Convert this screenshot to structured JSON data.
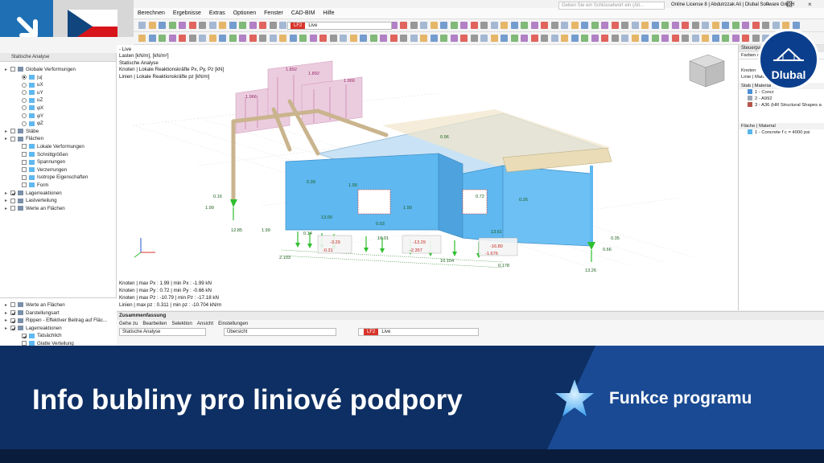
{
  "app": {
    "search_placeholder": "Geben Sie ein Schlüsselwort ein (Alt...",
    "license": "Online License 8 | Abdulrzzak Ali | Dlubal Software GmbH",
    "logo_text": "Dlubal"
  },
  "menu": [
    "Berechnen",
    "Ergebnisse",
    "Extras",
    "Optionen",
    "Fenster",
    "CAD-BIM",
    "Hilfe"
  ],
  "load_case": {
    "tag": "LF2",
    "name": "Live"
  },
  "navigator": {
    "header": "Statische Analyse",
    "items": [
      {
        "label": "Globale Verformungen",
        "kind": "cb",
        "depth": 0
      },
      {
        "label": "|u|",
        "kind": "rb-on",
        "depth": 1
      },
      {
        "label": "uX",
        "kind": "rb",
        "depth": 1
      },
      {
        "label": "uY",
        "kind": "rb",
        "depth": 1
      },
      {
        "label": "uZ",
        "kind": "rb",
        "depth": 1
      },
      {
        "label": "φX",
        "kind": "rb",
        "depth": 1
      },
      {
        "label": "φY",
        "kind": "rb",
        "depth": 1
      },
      {
        "label": "φZ",
        "kind": "rb",
        "depth": 1
      },
      {
        "label": "Stäbe",
        "kind": "cb",
        "depth": 0
      },
      {
        "label": "Flächen",
        "kind": "cb",
        "depth": 0
      },
      {
        "label": "Lokale Verformungen",
        "kind": "cb",
        "depth": 1
      },
      {
        "label": "Schnittgrößen",
        "kind": "cb",
        "depth": 1
      },
      {
        "label": "Spannungen",
        "kind": "cb",
        "depth": 1
      },
      {
        "label": "Verzerrungen",
        "kind": "cb",
        "depth": 1
      },
      {
        "label": "Isotrope Eigenschaften",
        "kind": "cb",
        "depth": 1
      },
      {
        "label": "Form",
        "kind": "cb",
        "depth": 1
      },
      {
        "label": "Lagerreaktionen",
        "kind": "cb-on",
        "depth": 0
      },
      {
        "label": "Lastverteilung",
        "kind": "cb",
        "depth": 0
      },
      {
        "label": "Werte an Flächen",
        "kind": "cb",
        "depth": 0
      }
    ],
    "lower_items": [
      {
        "label": "Werte an Flächen",
        "kind": "cb",
        "depth": 0
      },
      {
        "label": "Darstellungsart",
        "kind": "cb-on",
        "depth": 0
      },
      {
        "label": "Rippen - Effektiver Beitrag auf Fläc...",
        "kind": "cb-on",
        "depth": 0
      },
      {
        "label": "Lagerreaktionen",
        "kind": "cb-on",
        "depth": 0
      },
      {
        "label": "Tatsächlich",
        "kind": "cb-on",
        "depth": 1
      },
      {
        "label": "Glatte Verteilung",
        "kind": "cb",
        "depth": 1
      }
    ]
  },
  "viewport": {
    "header_lines": [
      "- Live",
      "Lasten [kN/m], [kN/m²]",
      "Statische Analyse",
      "Knoten | Lokale Reaktionskräfte Px, Py, Pz [kN]",
      "Linien | Lokale Reaktionskräfte pz [kN/m]"
    ],
    "footer_lines": [
      "Knoten | max Px : 1.99 | min Px : -1.99 kN",
      "Knoten | max Py : 0.72 | min Py : -0.66 kN",
      "Knoten | max Pz : -10.79 | min Pz : -17.18 kN",
      "Linien | max pz : 0.311 | min pz : -10.704 kN/m"
    ],
    "labels": {
      "l1": "1.966",
      "l2": "1.892",
      "l3": "1.892",
      "l4": "1.966",
      "l5": "0.16",
      "l6": "1.99",
      "l7": "12.85",
      "l8": "0.39",
      "l9": "1.99",
      "l10": "13.00",
      "l11": "0.03",
      "l12": "1.99",
      "l13": "0.14",
      "l14": "1.99",
      "l15": "16.01",
      "l16": "0.72",
      "l17": "0.26",
      "l18": "13.61",
      "l19": "0.35",
      "l20": "0.66",
      "l21": "13.26",
      "l22": "2.103",
      "l23": "10.104",
      "l24": "0.178",
      "l25": "0.96",
      "b1": "-3.29",
      "b2": "-0.31",
      "b3": "-13.29",
      "b4": "-2.357",
      "b5": "-16.80",
      "b6": "-1.676"
    }
  },
  "panel": {
    "title": "Steuerpanel",
    "subtitle": "Farben d",
    "knoten": "Knoten",
    "linie": "Linie | Material",
    "stab_header": "Stab | Material",
    "stab_items": [
      {
        "label": "1 - Concr",
        "color": "#4a90d9"
      },
      {
        "label": "2 - A992",
        "color": "#9aa6b2"
      },
      {
        "label": "3 - A36 (HR Structural Shapes a",
        "color": "#b5544b"
      }
    ],
    "flaeche_header": "Fläche | Material",
    "flaeche_items": [
      {
        "label": "1 - Concrete f´c = 4000 psi",
        "color": "#58b5ec"
      }
    ]
  },
  "summary": {
    "title": "Zusammenfassung",
    "menu": [
      "Gehe zu",
      "Bearbeiten",
      "Selektion",
      "Ansicht",
      "Einstellungen"
    ],
    "analysis": "Statische Analyse",
    "overview": "Übersicht",
    "lc_tag": "LF2",
    "lc_name": "Live"
  },
  "banner": {
    "title": "Info bubliny pro liniové podpory",
    "tag": "Funkce programu"
  },
  "colors": {
    "brand_dark": "#0e2f63",
    "accent_blue": "#1f6fb4",
    "concrete": "#5fb8f0",
    "support_green": "#2fbf2f",
    "load_pink": "#e6b8d2",
    "red": "#d9342b"
  }
}
